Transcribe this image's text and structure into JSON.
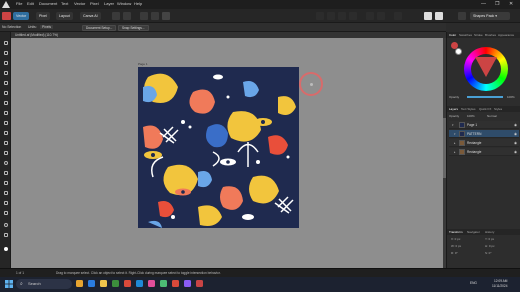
{
  "menubar": {
    "items": [
      "File",
      "Edit",
      "Document",
      "Text",
      "Vector",
      "Pixel",
      "Layer",
      "Window",
      "Help"
    ],
    "window_controls": [
      "—",
      "❐",
      "✕"
    ]
  },
  "toolbar": {
    "tool_buttons": [
      {
        "label": "Vector",
        "active": true
      },
      {
        "label": "Pixel",
        "active": false
      },
      {
        "label": "Layout",
        "active": false
      },
      {
        "label": "Canva AI",
        "active": false
      }
    ],
    "workspace_dropdown": "Shapes Pack",
    "workspace_chevron": "▾"
  },
  "context": {
    "label": "No Selection",
    "units_label": "Units:",
    "units_value": "Pixels",
    "document_setup": "Document Setup...",
    "snap_settings": "Snap Settings..."
  },
  "document": {
    "tab_title": "Untitled.af (Modified) (110.7%)",
    "artboard_label": "Page 1"
  },
  "panels": {
    "color_tabs": [
      "Color",
      "Swatches",
      "Stroke",
      "Brushes",
      "Appearance"
    ],
    "opacity_label": "Opacity",
    "opacity_value": "100%",
    "layers_tabs": [
      "Layers",
      "Text Styles",
      "Quick FX",
      "Styles"
    ],
    "opacity2_label": "Opacity",
    "opacity2_value": "100%",
    "blend_mode": "Normal",
    "layers": [
      {
        "name": "Page 1",
        "selected": false,
        "indent": 0,
        "arrow": "▾"
      },
      {
        "name": "PATTERN",
        "selected": true,
        "indent": 1,
        "arrow": "▾"
      },
      {
        "name": "Rectangle",
        "selected": false,
        "indent": 1,
        "arrow": "▸"
      },
      {
        "name": "Rectangle",
        "selected": false,
        "indent": 1,
        "arrow": "▸"
      }
    ],
    "transform_tabs": [
      "Transform",
      "Navigator",
      "History"
    ],
    "transform_rows": [
      "X: 0 px",
      "Y: 0 px",
      "W: 0 px",
      "H: 0 px",
      "R: 0°",
      "S: 0°"
    ]
  },
  "statusbar": {
    "left": "1 of 1",
    "hint": "Drag to marquee select. Click an object to select it. Right-Click during marquee select to toggle intersection behavior."
  },
  "taskbar": {
    "search_label": "Search",
    "search_icon": "⌕",
    "time": "12:09 AM",
    "date": "11/11/2024",
    "lang": "ENG"
  },
  "colors": {
    "accent": "#4aa0d5",
    "artboard_bg": "#1f2a4f",
    "pattern": [
      "#f2c53d",
      "#f07a5a",
      "#ffffff",
      "#3a6ec8",
      "#e94f3a",
      "#6aa6e8"
    ]
  }
}
